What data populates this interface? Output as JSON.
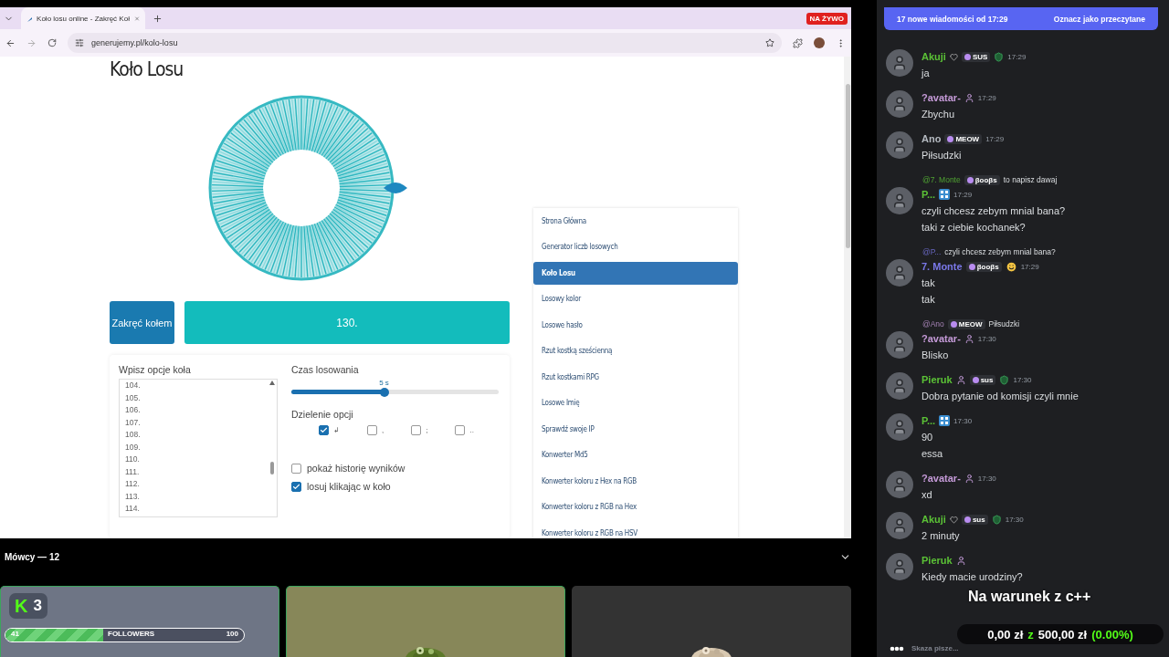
{
  "browser": {
    "tab_title": "Koło losu online - Zakręć Koł",
    "live_badge": "NA ŻYWO",
    "url": "generujemy.pl/kolo-losu"
  },
  "page": {
    "title": "Koło Losu",
    "spin_button": "Zakręć kołem",
    "result": "130.",
    "options_label": "Wpisz opcje koła",
    "options": [
      "104.",
      "105.",
      "106.",
      "107.",
      "108.",
      "109.",
      "110.",
      "111.",
      "112.",
      "113.",
      "114."
    ],
    "time_label": "Czas losowania",
    "time_slider": {
      "value": "5 s",
      "level": 0.45
    },
    "split_label": "Dzielenie opcji",
    "split_options": [
      {
        "label": "↲",
        "checked": true
      },
      {
        "label": ",",
        "checked": false
      },
      {
        "label": ";",
        "checked": false
      },
      {
        "label": "..",
        "checked": false
      }
    ],
    "checkboxes": [
      {
        "label": "pokaż historię wyników",
        "checked": false
      },
      {
        "label": "losuj klikając w koło",
        "checked": true
      }
    ],
    "nav": [
      {
        "label": "Strona Główna",
        "selected": false
      },
      {
        "label": "Generator liczb losowych",
        "selected": false
      },
      {
        "label": "Koło Losu",
        "selected": true
      },
      {
        "label": "Losowy kolor",
        "selected": false
      },
      {
        "label": "Losowe hasło",
        "selected": false
      },
      {
        "label": "Rzut kostką sześcienną",
        "selected": false
      },
      {
        "label": "Rzut kostkami RPG",
        "selected": false
      },
      {
        "label": "Losowe Imię",
        "selected": false
      },
      {
        "label": "Sprawdź swoje IP",
        "selected": false
      },
      {
        "label": "Konwerter Md5",
        "selected": false
      },
      {
        "label": "Konwerter koloru z Hex na RGB",
        "selected": false
      },
      {
        "label": "Konwerter koloru z RGB na Hex",
        "selected": false
      },
      {
        "label": "Konwerter koloru z RGB na HSV",
        "selected": false
      }
    ]
  },
  "speakers": {
    "title": "Mówcy — 12",
    "logo": "K",
    "count": "3",
    "followers_current": "41",
    "followers_label": "FOLLOWERS",
    "followers_goal": "100",
    "followers_bar": {
      "level": 0.41
    },
    "tiles": [
      {
        "kind": "stats",
        "speaking": true
      },
      {
        "kind": "picture",
        "speaking": true
      },
      {
        "kind": "picture",
        "speaking": false
      }
    ]
  },
  "chat": {
    "banner": "17 nowe wiadomości od 17:29",
    "mark_read": "Oznacz jako przeczytane",
    "messages": [
      {
        "name": "Akuji",
        "color": "#5bc236",
        "badges": [
          {
            "kind": "heart"
          },
          {
            "kind": "tag",
            "label": "SUS"
          },
          {
            "kind": "shield"
          }
        ],
        "time": "17:29",
        "lines": [
          "ja"
        ]
      },
      {
        "name": "?avatar-",
        "color": "#c59ad8",
        "badges": [
          {
            "kind": "figure"
          }
        ],
        "time": "17:29",
        "lines": [
          "Zbychu"
        ]
      },
      {
        "name": "Ano",
        "color": "#b5bac1",
        "badges": [
          {
            "kind": "tag",
            "label": "MEOW"
          }
        ],
        "time": "17:29",
        "lines": [
          "Piłsudzki"
        ]
      },
      {
        "reply": {
          "name": "@7. Monte",
          "tag": "βooβs",
          "text": "to napisz dawaj"
        },
        "name": "P...",
        "color": "#5bc236",
        "badges": [
          {
            "kind": "keycap"
          }
        ],
        "time": "17:29",
        "lines": [
          "czyli chcesz zebym mnial bana?",
          "taki z ciebie kochanek?"
        ]
      },
      {
        "reply": {
          "name": "@P...",
          "text": "czyli chcesz zebym mnial bana?"
        },
        "name": "7. Monte",
        "color": "#7a78e8",
        "badges": [
          {
            "kind": "tag",
            "label": "βooβs"
          },
          {
            "kind": "smiley"
          }
        ],
        "time": "17:29",
        "lines": [
          "tak",
          "tak"
        ]
      },
      {
        "reply": {
          "name": "@Ano",
          "tag": "MEOW",
          "text": "Piłsudzki"
        },
        "name": "?avatar-",
        "color": "#c59ad8",
        "badges": [
          {
            "kind": "figure"
          }
        ],
        "time": "17:30",
        "lines": [
          "Blisko"
        ]
      },
      {
        "name": "Pieruk",
        "color": "#5bc236",
        "badges": [
          {
            "kind": "figure"
          },
          {
            "kind": "tag",
            "label": "sus"
          },
          {
            "kind": "shield"
          }
        ],
        "time": "17:30",
        "lines": [
          "Dobra pytanie od komisji czyli mnie"
        ]
      },
      {
        "name": "P...",
        "color": "#5bc236",
        "badges": [
          {
            "kind": "keycap"
          }
        ],
        "time": "17:30",
        "lines": [
          "90",
          "essa"
        ]
      },
      {
        "name": "?avatar-",
        "color": "#c59ad8",
        "badges": [
          {
            "kind": "figure"
          }
        ],
        "time": "17:30",
        "lines": [
          "xd"
        ]
      },
      {
        "name": "Akuji",
        "color": "#5bc236",
        "badges": [
          {
            "kind": "heart"
          },
          {
            "kind": "tag",
            "label": "sus"
          },
          {
            "kind": "shield"
          }
        ],
        "time": "17:30",
        "lines": [
          "2 minuty"
        ]
      },
      {
        "name": "Pieruk",
        "color": "#5bc236",
        "badges": [
          {
            "kind": "figure"
          }
        ],
        "lines": [
          "Kiedy macie urodziny?"
        ]
      }
    ],
    "typing": "Skaza pisze..."
  },
  "overlay": {
    "goal_title": "Na warunek z c++",
    "raised": "0,00 zł",
    "joiner": "z",
    "goal": "500,00 zł",
    "percent": "(0.00%)"
  }
}
